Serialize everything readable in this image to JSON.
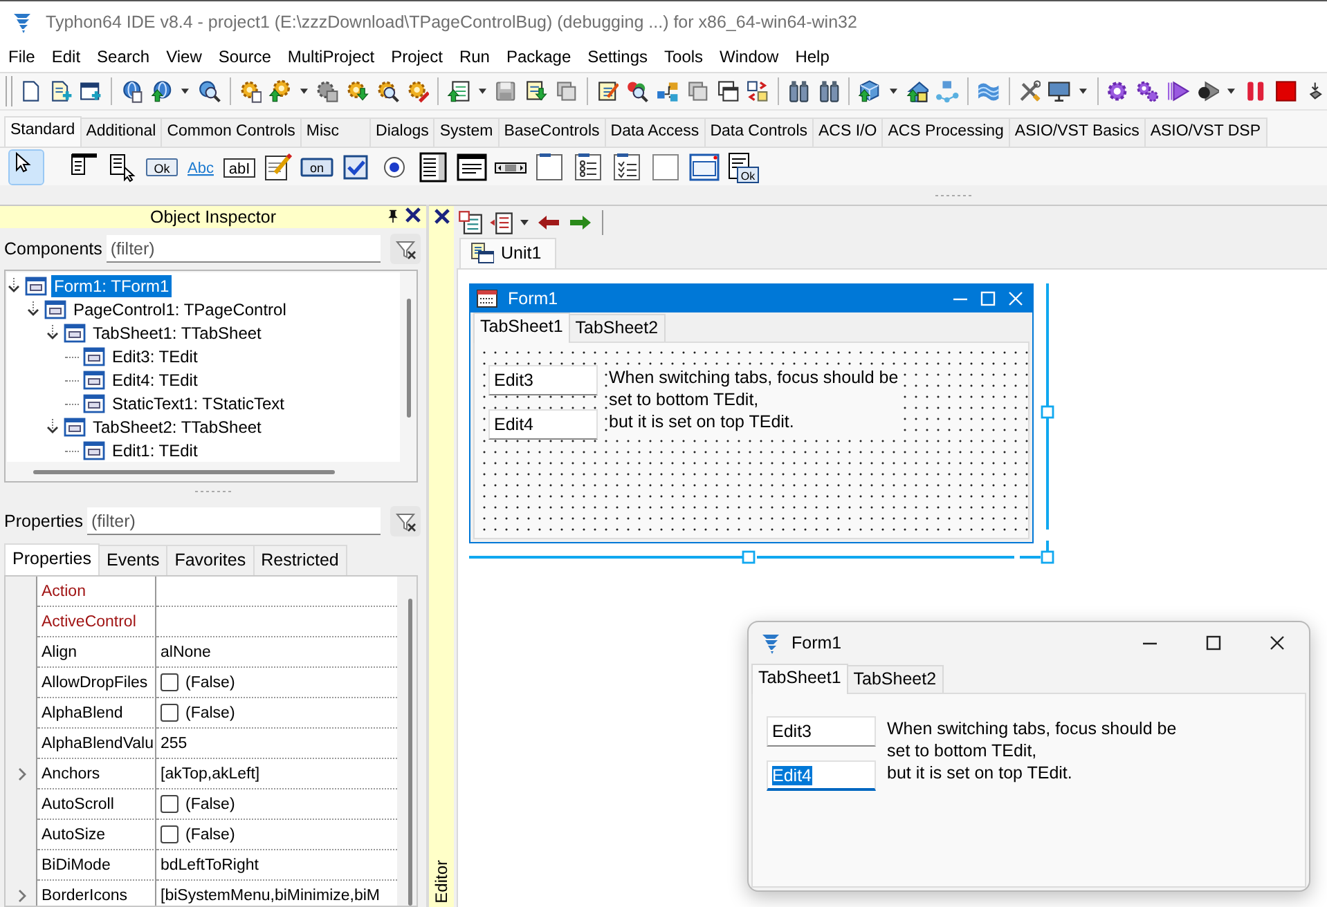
{
  "window": {
    "title": "Typhon64 IDE v8.4 - project1 (E:\\zzzDownload\\TPageControlBug) (debugging ...) for x86_64-win64-win32"
  },
  "menu": [
    "File",
    "Edit",
    "Search",
    "View",
    "Source",
    "MultiProject",
    "Project",
    "Run",
    "Package",
    "Settings",
    "Tools",
    "Window",
    "Help"
  ],
  "palette": {
    "tabs": [
      {
        "label": "Standard",
        "selected": true
      },
      {
        "label": "Additional",
        "selected": false
      },
      {
        "label": "Common Controls",
        "selected": false
      },
      {
        "label": "Misc",
        "selected": false
      },
      {
        "label": "Dialogs",
        "selected": false
      },
      {
        "label": "System",
        "selected": false
      },
      {
        "label": "BaseControls",
        "selected": false
      },
      {
        "label": "Data Access",
        "selected": false
      },
      {
        "label": "Data Controls",
        "selected": false
      },
      {
        "label": "ACS I/O",
        "selected": false
      },
      {
        "label": "ACS Processing",
        "selected": false
      },
      {
        "label": "ASIO/VST Basics",
        "selected": false
      },
      {
        "label": "ASIO/VST DSP",
        "selected": false
      }
    ],
    "components": [
      {
        "kind": "pointer",
        "selected": true
      },
      {
        "kind": "main-menu",
        "selected": false
      },
      {
        "kind": "popup-menu",
        "selected": false
      },
      {
        "kind": "button",
        "label": "Ok",
        "selected": false
      },
      {
        "kind": "label",
        "label": "Abc",
        "selected": false
      },
      {
        "kind": "edit",
        "label": "abI",
        "selected": false
      },
      {
        "kind": "memo",
        "selected": false
      },
      {
        "kind": "toggle",
        "label": "on",
        "selected": false
      },
      {
        "kind": "checkbox",
        "selected": false
      },
      {
        "kind": "radio",
        "selected": false
      },
      {
        "kind": "listbox",
        "selected": false
      },
      {
        "kind": "combobox",
        "selected": false
      },
      {
        "kind": "scrollbar",
        "selected": false
      },
      {
        "kind": "groupbox",
        "selected": false
      },
      {
        "kind": "radiogroup",
        "selected": false
      },
      {
        "kind": "checkgroup",
        "selected": false
      },
      {
        "kind": "panel",
        "selected": false
      },
      {
        "kind": "frame",
        "selected": false
      },
      {
        "kind": "buttonpanel",
        "label": "Ok",
        "selected": false
      }
    ]
  },
  "object_inspector": {
    "title": "Object Inspector",
    "components_filter": {
      "label": "Components",
      "placeholder": "(filter)"
    },
    "tree": [
      {
        "label": "Form1: TForm1",
        "selected": true,
        "expanded": true,
        "children": [
          {
            "label": "PageControl1: TPageControl",
            "selected": false,
            "expanded": true,
            "children": [
              {
                "label": "TabSheet1: TTabSheet",
                "selected": false,
                "expanded": true,
                "children": [
                  {
                    "label": "Edit3: TEdit",
                    "selected": false
                  },
                  {
                    "label": "Edit4: TEdit",
                    "selected": false
                  },
                  {
                    "label": "StaticText1: TStaticText",
                    "selected": false
                  }
                ]
              },
              {
                "label": "TabSheet2: TTabSheet",
                "selected": false,
                "expanded": true,
                "children": [
                  {
                    "label": "Edit1: TEdit",
                    "selected": false
                  }
                ]
              }
            ]
          }
        ]
      }
    ],
    "properties_filter": {
      "label": "Properties",
      "placeholder": "(filter)"
    },
    "tabs": [
      {
        "label": "Properties",
        "selected": true
      },
      {
        "label": "Events",
        "selected": false
      },
      {
        "label": "Favorites",
        "selected": false
      },
      {
        "label": "Restricted",
        "selected": false
      }
    ],
    "grid": [
      {
        "name": "Action",
        "kind": "text",
        "highlighted": true,
        "expandable": false
      },
      {
        "name": "ActiveControl",
        "kind": "text",
        "highlighted": true,
        "expandable": false
      },
      {
        "name": "Align",
        "kind": "text",
        "value": "alNone",
        "highlighted": false,
        "expandable": false
      },
      {
        "name": "AllowDropFiles",
        "kind": "checkbox",
        "checked": false,
        "value": "(False)",
        "highlighted": false,
        "expandable": false
      },
      {
        "name": "AlphaBlend",
        "kind": "checkbox",
        "checked": false,
        "value": "(False)",
        "highlighted": false,
        "expandable": false
      },
      {
        "name": "AlphaBlendValu",
        "kind": "text",
        "value": "255",
        "highlighted": false,
        "expandable": false
      },
      {
        "name": "Anchors",
        "kind": "text",
        "value": "[akTop,akLeft]",
        "highlighted": false,
        "expandable": true
      },
      {
        "name": "AutoScroll",
        "kind": "checkbox",
        "checked": false,
        "value": "(False)",
        "highlighted": false,
        "expandable": false
      },
      {
        "name": "AutoSize",
        "kind": "checkbox",
        "checked": false,
        "value": "(False)",
        "highlighted": false,
        "expandable": false
      },
      {
        "name": "BiDiMode",
        "kind": "text",
        "value": "bdLeftToRight",
        "highlighted": false,
        "expandable": false
      },
      {
        "name": "BorderIcons",
        "kind": "text",
        "value": "[biSystemMenu,biMinimize,biM",
        "highlighted": false,
        "expandable": true
      }
    ]
  },
  "editor": {
    "side_label": "Editor",
    "tabs": [
      {
        "label": "Unit1",
        "selected": true
      }
    ]
  },
  "forms": [
    {
      "kind": "designer",
      "title": "Form1",
      "tabs": [
        {
          "label": "TabSheet1",
          "selected": true
        },
        {
          "label": "TabSheet2",
          "selected": false
        }
      ],
      "edits": [
        {
          "value": "Edit3",
          "focused": false
        },
        {
          "value": "Edit4",
          "focused": false
        }
      ],
      "note": [
        "When switching tabs, focus should be",
        "set to bottom TEdit,",
        "but it is set on top TEdit."
      ]
    },
    {
      "kind": "running",
      "title": "Form1",
      "tabs": [
        {
          "label": "TabSheet1",
          "selected": true
        },
        {
          "label": "TabSheet2",
          "selected": false
        }
      ],
      "edits": [
        {
          "value": "Edit3",
          "focused": false
        },
        {
          "value": "Edit4",
          "focused": true
        }
      ],
      "note": [
        "When switching tabs, focus should be",
        "set to bottom TEdit,",
        "but it is set on top TEdit."
      ]
    }
  ]
}
